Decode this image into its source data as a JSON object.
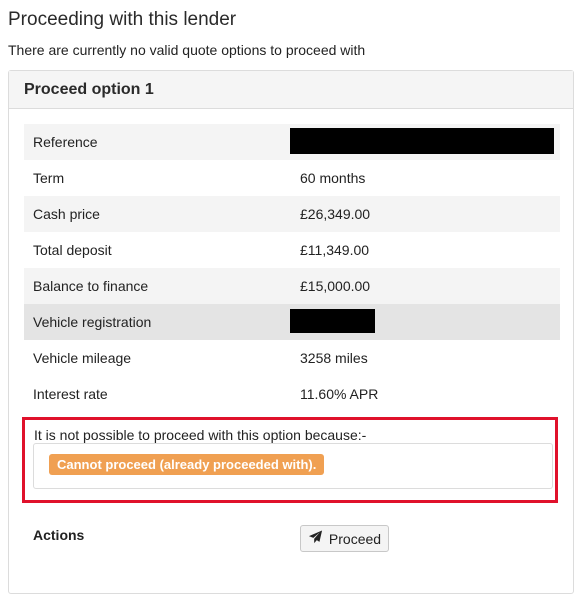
{
  "page": {
    "title": "Proceeding with this lender",
    "subtitle": "There are currently no valid quote options to proceed with"
  },
  "option": {
    "header": "Proceed option 1",
    "rows": [
      {
        "label": "Reference",
        "value": ""
      },
      {
        "label": "Term",
        "value": "60 months"
      },
      {
        "label": "Cash price",
        "value": "£26,349.00"
      },
      {
        "label": "Total deposit",
        "value": "£11,349.00"
      },
      {
        "label": "Balance to finance",
        "value": "£15,000.00"
      },
      {
        "label": "Vehicle registration",
        "value": ""
      },
      {
        "label": "Vehicle mileage",
        "value": "3258 miles"
      },
      {
        "label": "Interest rate",
        "value": "11.60% APR"
      }
    ],
    "reason_intro": "It is not possible to proceed with this option because:-",
    "reason_badge": "Cannot proceed (already proceeded with).",
    "actions_label": "Actions",
    "proceed_label": "Proceed"
  },
  "colors": {
    "badge": "#f0a052",
    "highlight_border": "#e0112b"
  },
  "icons": {
    "proceed": "paper-plane-icon"
  }
}
